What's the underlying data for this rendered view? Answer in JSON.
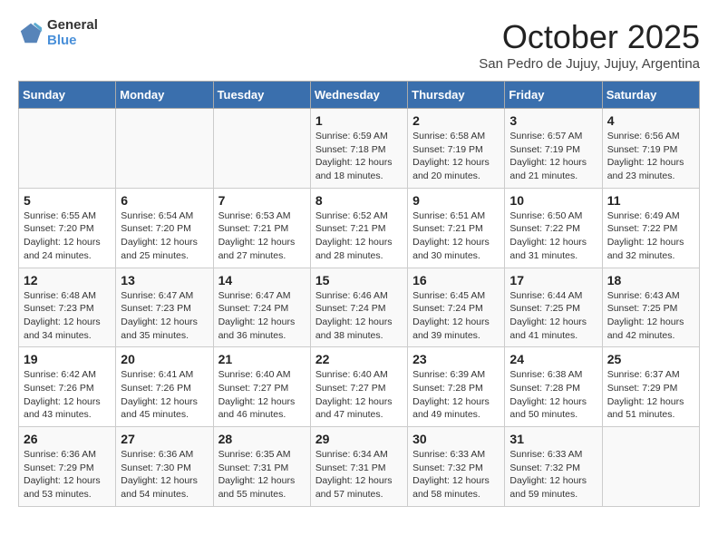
{
  "header": {
    "logo_general": "General",
    "logo_blue": "Blue",
    "month_title": "October 2025",
    "subtitle": "San Pedro de Jujuy, Jujuy, Argentina"
  },
  "weekdays": [
    "Sunday",
    "Monday",
    "Tuesday",
    "Wednesday",
    "Thursday",
    "Friday",
    "Saturday"
  ],
  "weeks": [
    [
      {
        "day": "",
        "info": ""
      },
      {
        "day": "",
        "info": ""
      },
      {
        "day": "",
        "info": ""
      },
      {
        "day": "1",
        "info": "Sunrise: 6:59 AM\nSunset: 7:18 PM\nDaylight: 12 hours\nand 18 minutes."
      },
      {
        "day": "2",
        "info": "Sunrise: 6:58 AM\nSunset: 7:19 PM\nDaylight: 12 hours\nand 20 minutes."
      },
      {
        "day": "3",
        "info": "Sunrise: 6:57 AM\nSunset: 7:19 PM\nDaylight: 12 hours\nand 21 minutes."
      },
      {
        "day": "4",
        "info": "Sunrise: 6:56 AM\nSunset: 7:19 PM\nDaylight: 12 hours\nand 23 minutes."
      }
    ],
    [
      {
        "day": "5",
        "info": "Sunrise: 6:55 AM\nSunset: 7:20 PM\nDaylight: 12 hours\nand 24 minutes."
      },
      {
        "day": "6",
        "info": "Sunrise: 6:54 AM\nSunset: 7:20 PM\nDaylight: 12 hours\nand 25 minutes."
      },
      {
        "day": "7",
        "info": "Sunrise: 6:53 AM\nSunset: 7:21 PM\nDaylight: 12 hours\nand 27 minutes."
      },
      {
        "day": "8",
        "info": "Sunrise: 6:52 AM\nSunset: 7:21 PM\nDaylight: 12 hours\nand 28 minutes."
      },
      {
        "day": "9",
        "info": "Sunrise: 6:51 AM\nSunset: 7:21 PM\nDaylight: 12 hours\nand 30 minutes."
      },
      {
        "day": "10",
        "info": "Sunrise: 6:50 AM\nSunset: 7:22 PM\nDaylight: 12 hours\nand 31 minutes."
      },
      {
        "day": "11",
        "info": "Sunrise: 6:49 AM\nSunset: 7:22 PM\nDaylight: 12 hours\nand 32 minutes."
      }
    ],
    [
      {
        "day": "12",
        "info": "Sunrise: 6:48 AM\nSunset: 7:23 PM\nDaylight: 12 hours\nand 34 minutes."
      },
      {
        "day": "13",
        "info": "Sunrise: 6:47 AM\nSunset: 7:23 PM\nDaylight: 12 hours\nand 35 minutes."
      },
      {
        "day": "14",
        "info": "Sunrise: 6:47 AM\nSunset: 7:24 PM\nDaylight: 12 hours\nand 36 minutes."
      },
      {
        "day": "15",
        "info": "Sunrise: 6:46 AM\nSunset: 7:24 PM\nDaylight: 12 hours\nand 38 minutes."
      },
      {
        "day": "16",
        "info": "Sunrise: 6:45 AM\nSunset: 7:24 PM\nDaylight: 12 hours\nand 39 minutes."
      },
      {
        "day": "17",
        "info": "Sunrise: 6:44 AM\nSunset: 7:25 PM\nDaylight: 12 hours\nand 41 minutes."
      },
      {
        "day": "18",
        "info": "Sunrise: 6:43 AM\nSunset: 7:25 PM\nDaylight: 12 hours\nand 42 minutes."
      }
    ],
    [
      {
        "day": "19",
        "info": "Sunrise: 6:42 AM\nSunset: 7:26 PM\nDaylight: 12 hours\nand 43 minutes."
      },
      {
        "day": "20",
        "info": "Sunrise: 6:41 AM\nSunset: 7:26 PM\nDaylight: 12 hours\nand 45 minutes."
      },
      {
        "day": "21",
        "info": "Sunrise: 6:40 AM\nSunset: 7:27 PM\nDaylight: 12 hours\nand 46 minutes."
      },
      {
        "day": "22",
        "info": "Sunrise: 6:40 AM\nSunset: 7:27 PM\nDaylight: 12 hours\nand 47 minutes."
      },
      {
        "day": "23",
        "info": "Sunrise: 6:39 AM\nSunset: 7:28 PM\nDaylight: 12 hours\nand 49 minutes."
      },
      {
        "day": "24",
        "info": "Sunrise: 6:38 AM\nSunset: 7:28 PM\nDaylight: 12 hours\nand 50 minutes."
      },
      {
        "day": "25",
        "info": "Sunrise: 6:37 AM\nSunset: 7:29 PM\nDaylight: 12 hours\nand 51 minutes."
      }
    ],
    [
      {
        "day": "26",
        "info": "Sunrise: 6:36 AM\nSunset: 7:29 PM\nDaylight: 12 hours\nand 53 minutes."
      },
      {
        "day": "27",
        "info": "Sunrise: 6:36 AM\nSunset: 7:30 PM\nDaylight: 12 hours\nand 54 minutes."
      },
      {
        "day": "28",
        "info": "Sunrise: 6:35 AM\nSunset: 7:31 PM\nDaylight: 12 hours\nand 55 minutes."
      },
      {
        "day": "29",
        "info": "Sunrise: 6:34 AM\nSunset: 7:31 PM\nDaylight: 12 hours\nand 57 minutes."
      },
      {
        "day": "30",
        "info": "Sunrise: 6:33 AM\nSunset: 7:32 PM\nDaylight: 12 hours\nand 58 minutes."
      },
      {
        "day": "31",
        "info": "Sunrise: 6:33 AM\nSunset: 7:32 PM\nDaylight: 12 hours\nand 59 minutes."
      },
      {
        "day": "",
        "info": ""
      }
    ]
  ]
}
